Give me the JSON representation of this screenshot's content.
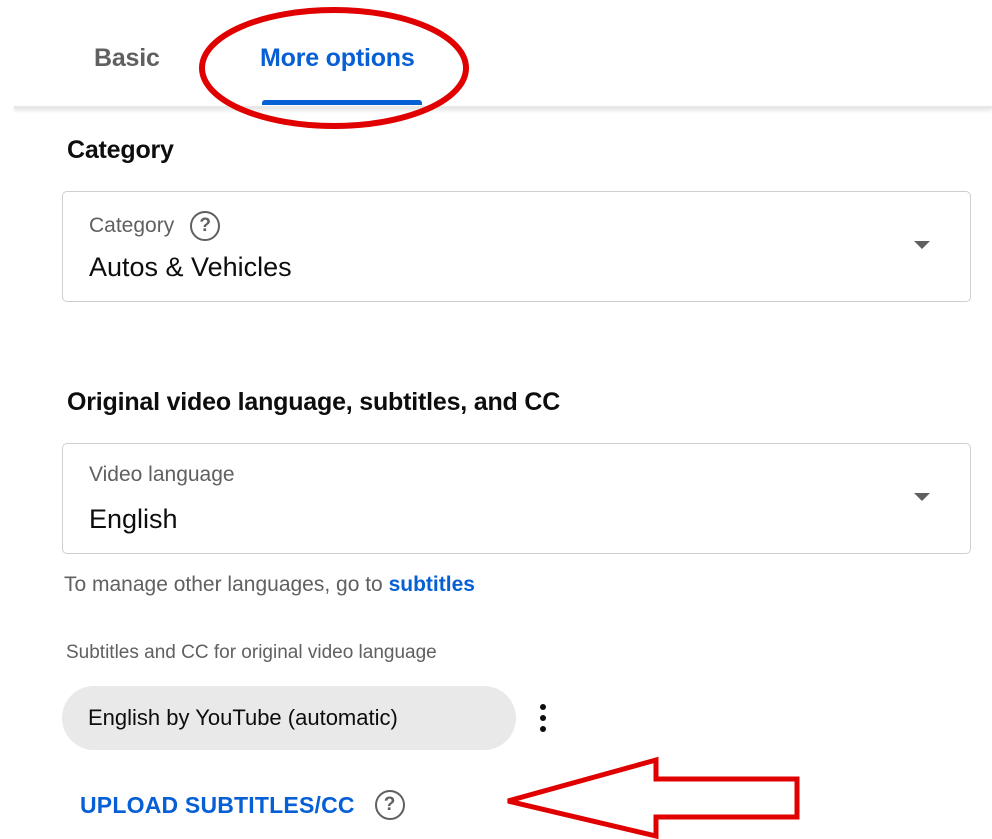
{
  "tabs": [
    {
      "label": "Basic",
      "active": false
    },
    {
      "label": "More options",
      "active": true
    }
  ],
  "category_section": {
    "title": "Category",
    "field_label": "Category",
    "value": "Autos & Vehicles"
  },
  "language_section": {
    "title": "Original video language, subtitles, and CC",
    "field_label": "Video language",
    "value": "English",
    "hint_prefix": "To manage other languages, go to",
    "hint_link": "subtitles",
    "subtitles_label": "Subtitles and CC for original video language",
    "chip_label": "English by YouTube (automatic)",
    "upload_button": "UPLOAD SUBTITLES/CC"
  },
  "colors": {
    "accent": "#065fd4",
    "annotation": "#e00000",
    "muted_text": "#606060"
  },
  "icons": {
    "help": "question-mark-circle-icon",
    "dropdown": "caret-down-icon",
    "more": "vertical-dots-icon"
  }
}
